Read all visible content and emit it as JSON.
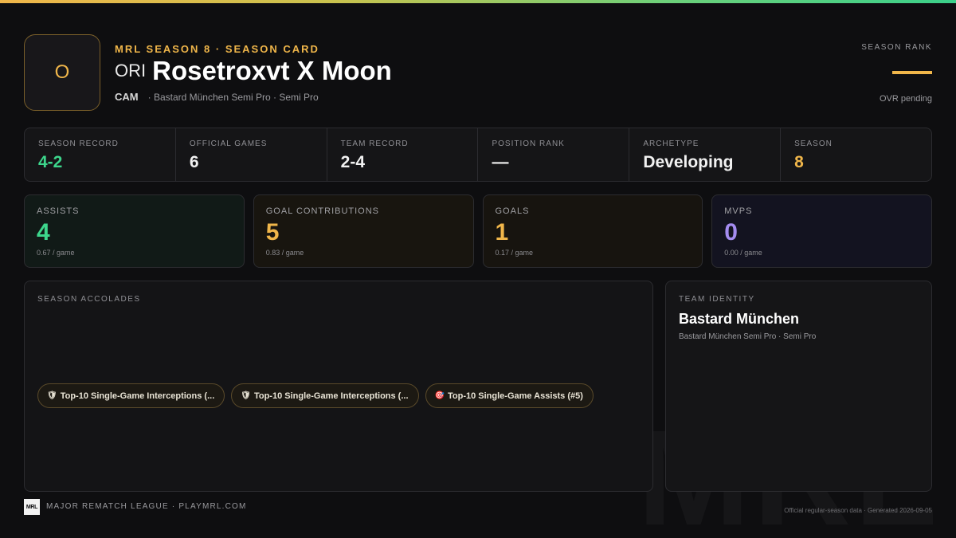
{
  "header": {
    "avatar_letter": "O",
    "kicker": "MRL SEASON 8 · SEASON CARD",
    "club_tag": "ORI",
    "player_name": "Rosetroxvt X Moon",
    "position": "CAM",
    "team_line": "· Bastard München Semi Pro · Semi Pro",
    "rank_label": "SEASON RANK",
    "rank_status": "OVR pending"
  },
  "strip": [
    {
      "label": "SEASON RECORD",
      "value": "4-2"
    },
    {
      "label": "OFFICIAL GAMES",
      "value": "6"
    },
    {
      "label": "TEAM RECORD",
      "value": "2-4"
    },
    {
      "label": "POSITION RANK",
      "value": "—"
    },
    {
      "label": "ARCHETYPE",
      "value": "Developing"
    },
    {
      "label": "SEASON",
      "value": "8"
    }
  ],
  "cards": [
    {
      "label": "ASSISTS",
      "value": "4",
      "sub": "0.67 / game"
    },
    {
      "label": "GOAL CONTRIBUTIONS",
      "value": "5",
      "sub": "0.83 / game"
    },
    {
      "label": "GOALS",
      "value": "1",
      "sub": "0.17 / game"
    },
    {
      "label": "MVPS",
      "value": "0",
      "sub": "0.00 / game"
    }
  ],
  "accolades": {
    "label": "SEASON ACCOLADES",
    "chips": [
      {
        "icon": "shield-icon",
        "glyph": "🛡",
        "text": "Top-10 Single-Game Interceptions (..."
      },
      {
        "icon": "shield-icon",
        "glyph": "🛡",
        "text": "Top-10 Single-Game Interceptions (..."
      },
      {
        "icon": "target-icon",
        "glyph": "🎯",
        "text": "Top-10 Single-Game Assists (#5)"
      }
    ]
  },
  "identity": {
    "label": "TEAM IDENTITY",
    "team_name": "Bastard München",
    "team_desc": "Bastard München Semi Pro · Semi Pro"
  },
  "footer": {
    "logo_text": "MRL",
    "left": "MAJOR REMATCH LEAGUE · PLAYMRL.COM",
    "right": "Official regular-season data · Generated 2026-09-05"
  },
  "watermark": "MRL",
  "colors": {
    "accent_gold": "#f0b64a",
    "accent_green": "#3dd68c",
    "accent_purple": "#a48cf0",
    "background": "#0e0e10"
  }
}
